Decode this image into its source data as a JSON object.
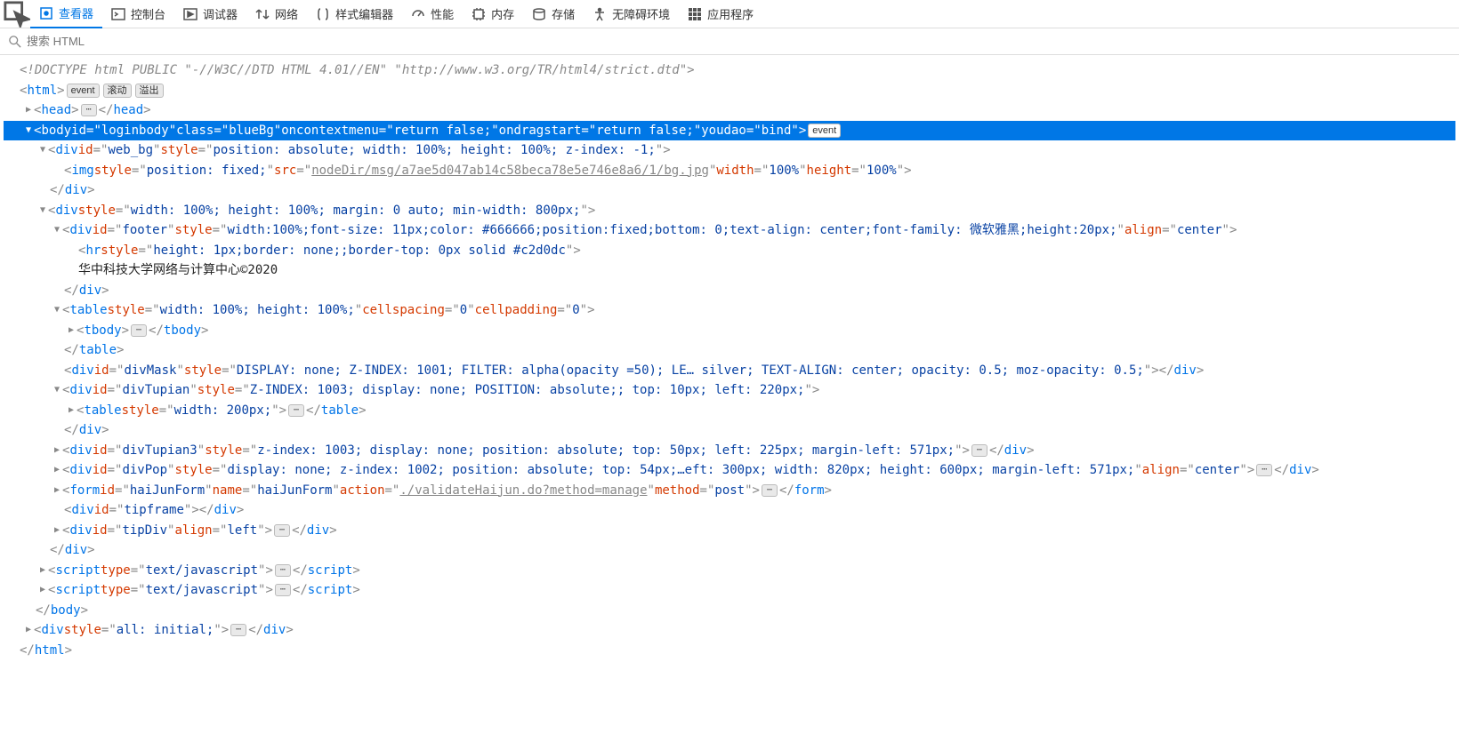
{
  "toolbar": {
    "inspector": "查看器",
    "console": "控制台",
    "debugger": "调试器",
    "network": "网络",
    "style": "样式编辑器",
    "perf": "性能",
    "memory": "内存",
    "storage": "存储",
    "a11y": "无障碍环境",
    "app": "应用程序"
  },
  "search": {
    "placeholder": "搜索 HTML"
  },
  "badges": {
    "event": "event",
    "scroll": "滚动",
    "overflow": "溢出"
  },
  "doctype": "<!DOCTYPE html PUBLIC \"-//W3C//DTD HTML 4.01//EN\" \"http://www.w3.org/TR/html4/strict.dtd\">",
  "nodes": {
    "html_open": "html",
    "head": "head",
    "body": {
      "tag": "body",
      "id": "loginbody",
      "class": "blueBg",
      "oncontextmenu": "return false;",
      "ondragstart": "return false;",
      "youdao": "bind"
    },
    "web_bg": {
      "tag": "div",
      "id": "web_bg",
      "style": "position: absolute; width: 100%; height: 100%; z-index: -1;"
    },
    "img": {
      "tag": "img",
      "style": "position: fixed;",
      "src": "nodeDir/msg/a7ae5d047ab14c58beca78e5e746e8a6/1/bg.jpg",
      "width": "100%",
      "height": "100%"
    },
    "outerdiv": {
      "tag": "div",
      "style": "width: 100%; height: 100%; margin: 0 auto; min-width: 800px;"
    },
    "footer": {
      "tag": "div",
      "id": "footer",
      "style": "width:100%;font-size: 11px;color: #666666;position:fixed;bottom: 0;text-align: center;font-family: 微软雅黑;height:20px;",
      "align": "center"
    },
    "hr": {
      "tag": "hr",
      "style": "height: 1px;border: none;;border-top: 0px solid #c2d0dc"
    },
    "footer_text": "华中科技大学网络与计算中心©2020",
    "table": {
      "tag": "table",
      "style": "width: 100%; height: 100%;",
      "cellspacing": "0",
      "cellpadding": "0"
    },
    "tbody": "tbody",
    "divMask": {
      "tag": "div",
      "id": "divMask",
      "style": "DISPLAY: none; Z-INDEX: 1001; FILTER: alpha(opacity =50); LE… silver; TEXT-ALIGN: center; opacity: 0.5; moz-opacity: 0.5;"
    },
    "divTupian": {
      "tag": "div",
      "id": "divTupian",
      "style": "Z-INDEX: 1003; display: none; POSITION: absolute;; top: 10px; left: 220px;"
    },
    "innerTable": {
      "tag": "table",
      "style": "width: 200px;"
    },
    "divTupian3": {
      "tag": "div",
      "id": "divTupian3",
      "style": "z-index: 1003; display: none; position: absolute; top: 50px; left: 225px; margin-left: 571px;"
    },
    "divPop": {
      "tag": "div",
      "id": "divPop",
      "style": "display: none; z-index: 1002; position: absolute; top: 54px;…eft: 300px; width: 820px; height: 600px; margin-left: 571px;",
      "align": "center"
    },
    "form": {
      "tag": "form",
      "id": "haiJunForm",
      "name": "haiJunForm",
      "action": "./validateHaijun.do?method=manage",
      "method": "post"
    },
    "tipframe": {
      "tag": "div",
      "id": "tipframe"
    },
    "tipDiv": {
      "tag": "div",
      "id": "tipDiv",
      "align": "left"
    },
    "script": {
      "tag": "script",
      "type": "text/javascript"
    },
    "divall": {
      "tag": "div",
      "style": "all: initial;"
    }
  }
}
